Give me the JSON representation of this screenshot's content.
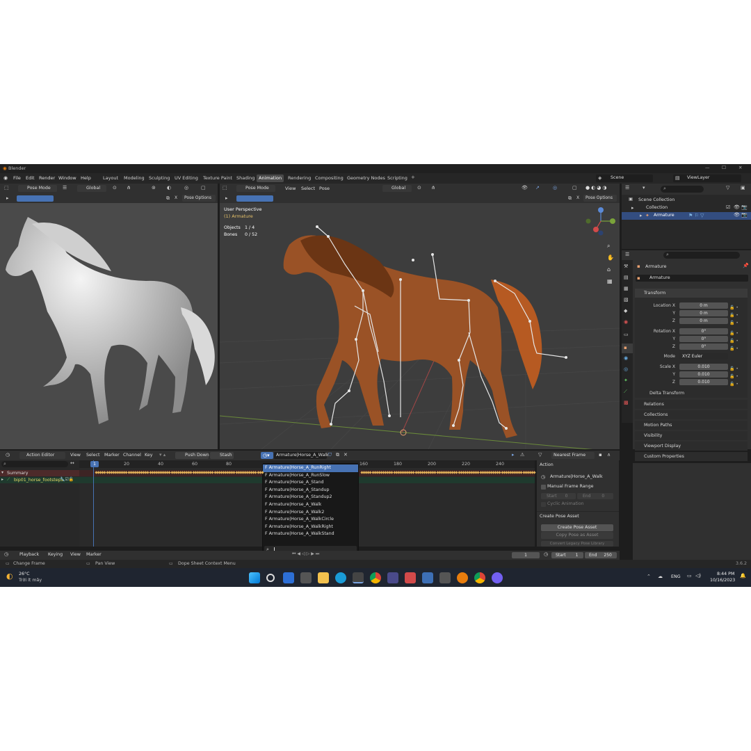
{
  "window": {
    "title": "Blender",
    "version": "3.6.2"
  },
  "menu": [
    "File",
    "Edit",
    "Render",
    "Window",
    "Help"
  ],
  "workspaces": [
    "Layout",
    "Modeling",
    "Sculpting",
    "UV Editing",
    "Texture Paint",
    "Shading",
    "Animation",
    "Rendering",
    "Compositing",
    "Geometry Nodes",
    "Scripting"
  ],
  "scene": {
    "name": "Scene",
    "view_layer": "ViewLayer"
  },
  "left_viewport": {
    "mode": "Pose Mode",
    "orientation": "Global",
    "pose_options": "Pose Options"
  },
  "main_viewport": {
    "mode": "Pose Mode",
    "menu": [
      "View",
      "Select",
      "Pose"
    ],
    "orientation": "Global",
    "pose_options": "Pose Options",
    "perspective": "User Perspective",
    "active": "(1) Armature",
    "objects_label": "Objects",
    "objects_value": "1 / 4",
    "bones_label": "Bones",
    "bones_value": "0 / 52"
  },
  "outliner": {
    "scene_collection": "Scene Collection",
    "collection": "Collection",
    "armature": "Armature"
  },
  "properties": {
    "object_name": "Armature",
    "data_name": "Armature",
    "transform_label": "Transform",
    "location": {
      "label": "Location X",
      "x": "0 m",
      "y": "0 m",
      "z": "0 m"
    },
    "rotation": {
      "label": "Rotation X",
      "x": "0°",
      "y": "0°",
      "z": "0°"
    },
    "mode_label": "Mode",
    "mode_value": "XYZ Euler",
    "scale": {
      "label": "Scale X",
      "x": "0.010",
      "y": "0.010",
      "z": "0.010"
    },
    "axis_y": "Y",
    "axis_z": "Z",
    "sections": [
      "Delta Transform",
      "Relations",
      "Collections",
      "Motion Paths",
      "Visibility",
      "Viewport Display",
      "Custom Properties"
    ]
  },
  "action_editor": {
    "editor_type": "Action Editor",
    "menu": [
      "View",
      "Select",
      "Marker",
      "Channel",
      "Key"
    ],
    "push_down": "Push Down",
    "stash": "Stash",
    "action_name": "Armature|Horse_A_Walk",
    "snap": "Nearest Frame",
    "ruler": [
      "1",
      "20",
      "40",
      "60",
      "80",
      "160",
      "180",
      "200",
      "220",
      "240"
    ],
    "summary": "Summary",
    "channel": "bip01_horse_footsteps",
    "dropdown": [
      "F Armature|Horse_A_RunRight",
      "F Armature|Horse_A_RunSlow",
      "F Armature|Horse_A_Stand",
      "F Armature|Horse_A_Standup",
      "F Armature|Horse_A_Standup2",
      "F Armature|Horse_A_Walk",
      "F Armature|Horse_A_Walk2",
      "F Armature|Horse_A_WalkCircle",
      "F Armature|Horse_A_WalkRight",
      "F Armature|Horse_A_WalkStand"
    ],
    "side_action": "Action",
    "side_action_name": "Armature|Horse_A_Walk",
    "manual_range": "Manual Frame Range",
    "start_label": "Start",
    "start_val": "0",
    "end_label": "End",
    "end_val": "0",
    "cyclic": "Cyclic Animation",
    "create_pose_header": "Create Pose Asset",
    "create_pose_btn": "Create Pose Asset",
    "copy_pose_btn": "Copy Pose as Asset",
    "convert_btn": "Convert Legacy Pose Library"
  },
  "timeline": {
    "menu": [
      "Playback",
      "Keying",
      "View",
      "Marker"
    ],
    "current_frame": "1",
    "start_label": "Start",
    "start": "1",
    "end_label": "End",
    "end": "250"
  },
  "statusbar": {
    "left": "Change Frame",
    "mid": "Pan View",
    "right": "Dope Sheet Context Menu"
  },
  "taskbar": {
    "temp": "26°C",
    "weather": "Trời ít mây",
    "lang": "ENG",
    "time": "8:44 PM",
    "date": "10/16/2023"
  },
  "colors": {
    "accent": "#4772b3",
    "keyframe": "#e3b25a",
    "bg": "#1d1d1d"
  }
}
